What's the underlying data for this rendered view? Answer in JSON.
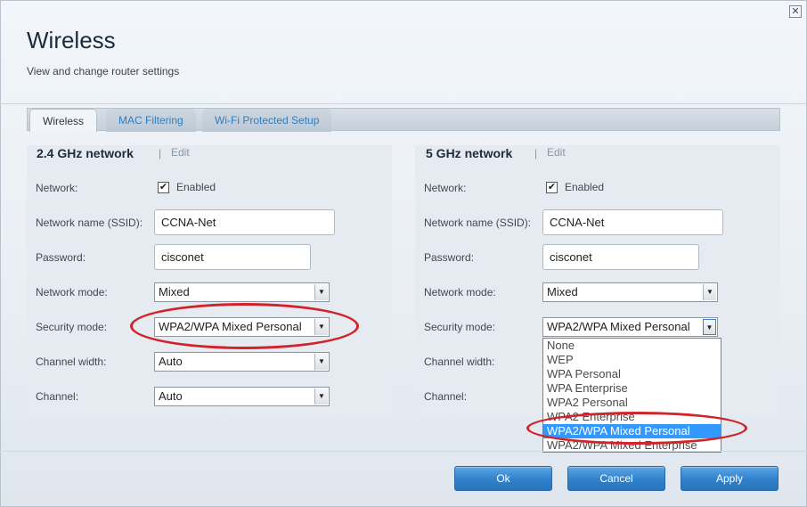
{
  "header": {
    "title": "Wireless",
    "subtitle": "View and change router settings",
    "close_glyph": "✕"
  },
  "tabs": [
    {
      "label": "Wireless",
      "active": true
    },
    {
      "label": "MAC Filtering",
      "active": false
    },
    {
      "label": "Wi-Fi Protected Setup",
      "active": false
    }
  ],
  "left_panel": {
    "heading": "2.4 GHz network",
    "separator": "|",
    "edit": "Edit",
    "labels": {
      "network": "Network:",
      "ssid": "Network name (SSID):",
      "password": "Password:",
      "mode": "Network mode:",
      "security": "Security mode:",
      "channel_width": "Channel width:",
      "channel": "Channel:"
    },
    "enabled_label": "Enabled",
    "ssid_value": "CCNA-Net",
    "password_value": "cisconet",
    "mode_value": "Mixed",
    "security_value": "WPA2/WPA Mixed Personal",
    "channel_width_value": "Auto",
    "channel_value": "Auto"
  },
  "right_panel": {
    "heading": "5 GHz network",
    "separator": "|",
    "edit": "Edit",
    "labels": {
      "network": "Network:",
      "ssid": "Network name (SSID):",
      "password": "Password:",
      "mode": "Network mode:",
      "security": "Security mode:",
      "channel_width": "Channel width:",
      "channel": "Channel:"
    },
    "enabled_label": "Enabled",
    "ssid_value": "CCNA-Net",
    "password_value": "cisconet",
    "mode_value": "Mixed",
    "security_value": "WPA2/WPA Mixed Personal",
    "security_options": [
      "None",
      "WEP",
      "WPA Personal",
      "WPA Enterprise",
      "WPA2 Personal",
      "WPA2 Enterprise",
      "WPA2/WPA Mixed Personal",
      "WPA2/WPA Mixed Enterprise"
    ],
    "selected_option_index": 6
  },
  "footer": {
    "ok": "Ok",
    "cancel": "Cancel",
    "apply": "Apply"
  },
  "colors": {
    "accent": "#2f81cc",
    "highlight": "#3399ff",
    "annotation": "#d2232a"
  }
}
